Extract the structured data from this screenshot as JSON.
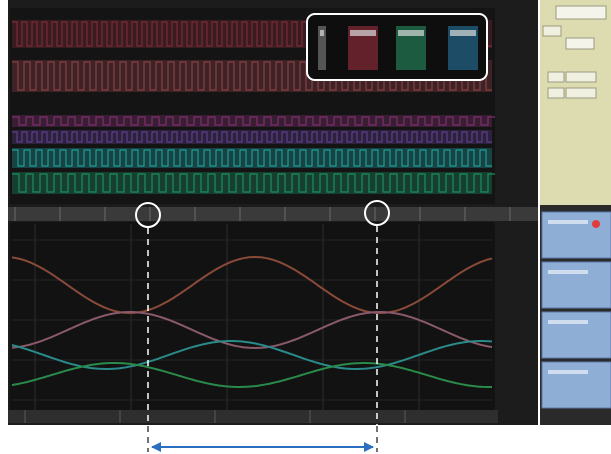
{
  "app": {
    "title": "",
    "window_bg": "#1c1c1c",
    "right_panel_bg": "#dddcb0",
    "button_bg": "#8faed6",
    "record_color": "#e23b3b"
  },
  "digital_pane": {
    "bands": [
      {
        "name": "band-1",
        "color": "#7b2a37"
      },
      {
        "name": "band-2",
        "color": "#8a3f45"
      },
      {
        "name": "band-3",
        "color": "#7d2f6e"
      },
      {
        "name": "band-4",
        "color": "#5d3d8a"
      },
      {
        "name": "band-5",
        "color": "#1f9a9a"
      },
      {
        "name": "band-6",
        "color": "#1b8e62"
      }
    ]
  },
  "channel_readout": {
    "entries": [
      {
        "name": "channel-1",
        "color": "#c0c0c0"
      },
      {
        "name": "channel-2",
        "color": "#aa3344"
      },
      {
        "name": "channel-3",
        "color": "#2a9a6a"
      },
      {
        "name": "channel-4",
        "color": "#2a7fb0"
      }
    ]
  },
  "analog_pane": {
    "traces": [
      {
        "name": "trace-brown",
        "color": "#8a4a3a"
      },
      {
        "name": "trace-mauve",
        "color": "#8a5a6a"
      },
      {
        "name": "trace-teal",
        "color": "#2a8a8a"
      },
      {
        "name": "trace-green",
        "color": "#2a8a4a"
      }
    ]
  },
  "cursors": {
    "marker_style": "white-circle",
    "dashed_lines": true,
    "span_arrow_color": "#2a6fbf"
  },
  "right_panel": {
    "buttons": [
      {
        "name": "function-button-1",
        "has_record_dot": true
      },
      {
        "name": "function-button-2",
        "has_record_dot": false
      },
      {
        "name": "function-button-3",
        "has_record_dot": false
      },
      {
        "name": "function-button-4",
        "has_record_dot": false
      }
    ]
  }
}
